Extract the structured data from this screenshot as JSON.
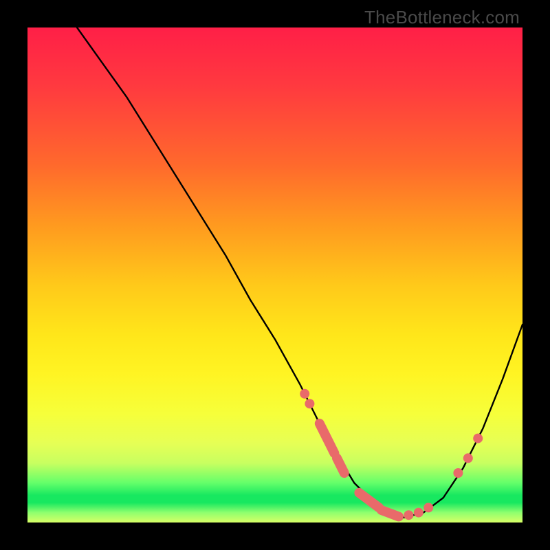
{
  "watermark": "TheBottleneck.com",
  "colors": {
    "background_black": "#000000",
    "gradient_top": "#ff1f47",
    "gradient_mid": "#ffe61a",
    "gradient_green": "#18e860",
    "curve": "#000000",
    "marker": "#e96a6a"
  },
  "chart_data": {
    "type": "line",
    "title": "",
    "xlabel": "",
    "ylabel": "",
    "xlim": [
      0,
      100
    ],
    "ylim": [
      0,
      100
    ],
    "note": "No axes, ticks, or labels are rendered. Y is bottleneck severity (0=none/green, 100=max/red). X is an unlabeled horizontal parameter. Values are estimated from the plotted curve against the color gradient.",
    "series": [
      {
        "name": "bottleneck-curve",
        "x": [
          10,
          15,
          20,
          25,
          30,
          35,
          40,
          45,
          50,
          55,
          58,
          60,
          63,
          66,
          70,
          73,
          76,
          80,
          84,
          88,
          92,
          96,
          100
        ],
        "y": [
          100,
          93,
          86,
          78,
          70,
          62,
          54,
          45,
          37,
          28,
          22,
          18,
          13,
          8,
          4,
          2,
          1,
          2,
          5,
          11,
          19,
          29,
          40
        ]
      }
    ],
    "markers": [
      {
        "name": "left-cluster-dot-1",
        "x": 56,
        "y": 26,
        "style": "dot"
      },
      {
        "name": "left-cluster-dot-2",
        "x": 57,
        "y": 24,
        "style": "dot"
      },
      {
        "name": "left-cluster-segment-1",
        "x0": 59,
        "y0": 20,
        "x1": 62,
        "y1": 14,
        "style": "segment"
      },
      {
        "name": "left-cluster-segment-2",
        "x0": 62.5,
        "y0": 13,
        "x1": 64,
        "y1": 10,
        "style": "segment"
      },
      {
        "name": "valley-segment-1",
        "x0": 67,
        "y0": 6,
        "x1": 71,
        "y1": 3,
        "style": "segment"
      },
      {
        "name": "valley-segment-2",
        "x0": 71.5,
        "y0": 2.5,
        "x1": 75,
        "y1": 1.2,
        "style": "segment"
      },
      {
        "name": "valley-dot-1",
        "x": 77,
        "y": 1.5,
        "style": "dot"
      },
      {
        "name": "valley-dot-2",
        "x": 79,
        "y": 2,
        "style": "dot"
      },
      {
        "name": "valley-dot-3",
        "x": 81,
        "y": 3,
        "style": "dot"
      },
      {
        "name": "right-dot-1",
        "x": 87,
        "y": 10,
        "style": "dot"
      },
      {
        "name": "right-dot-2",
        "x": 89,
        "y": 13,
        "style": "dot"
      },
      {
        "name": "right-dot-3",
        "x": 91,
        "y": 17,
        "style": "dot"
      }
    ]
  }
}
